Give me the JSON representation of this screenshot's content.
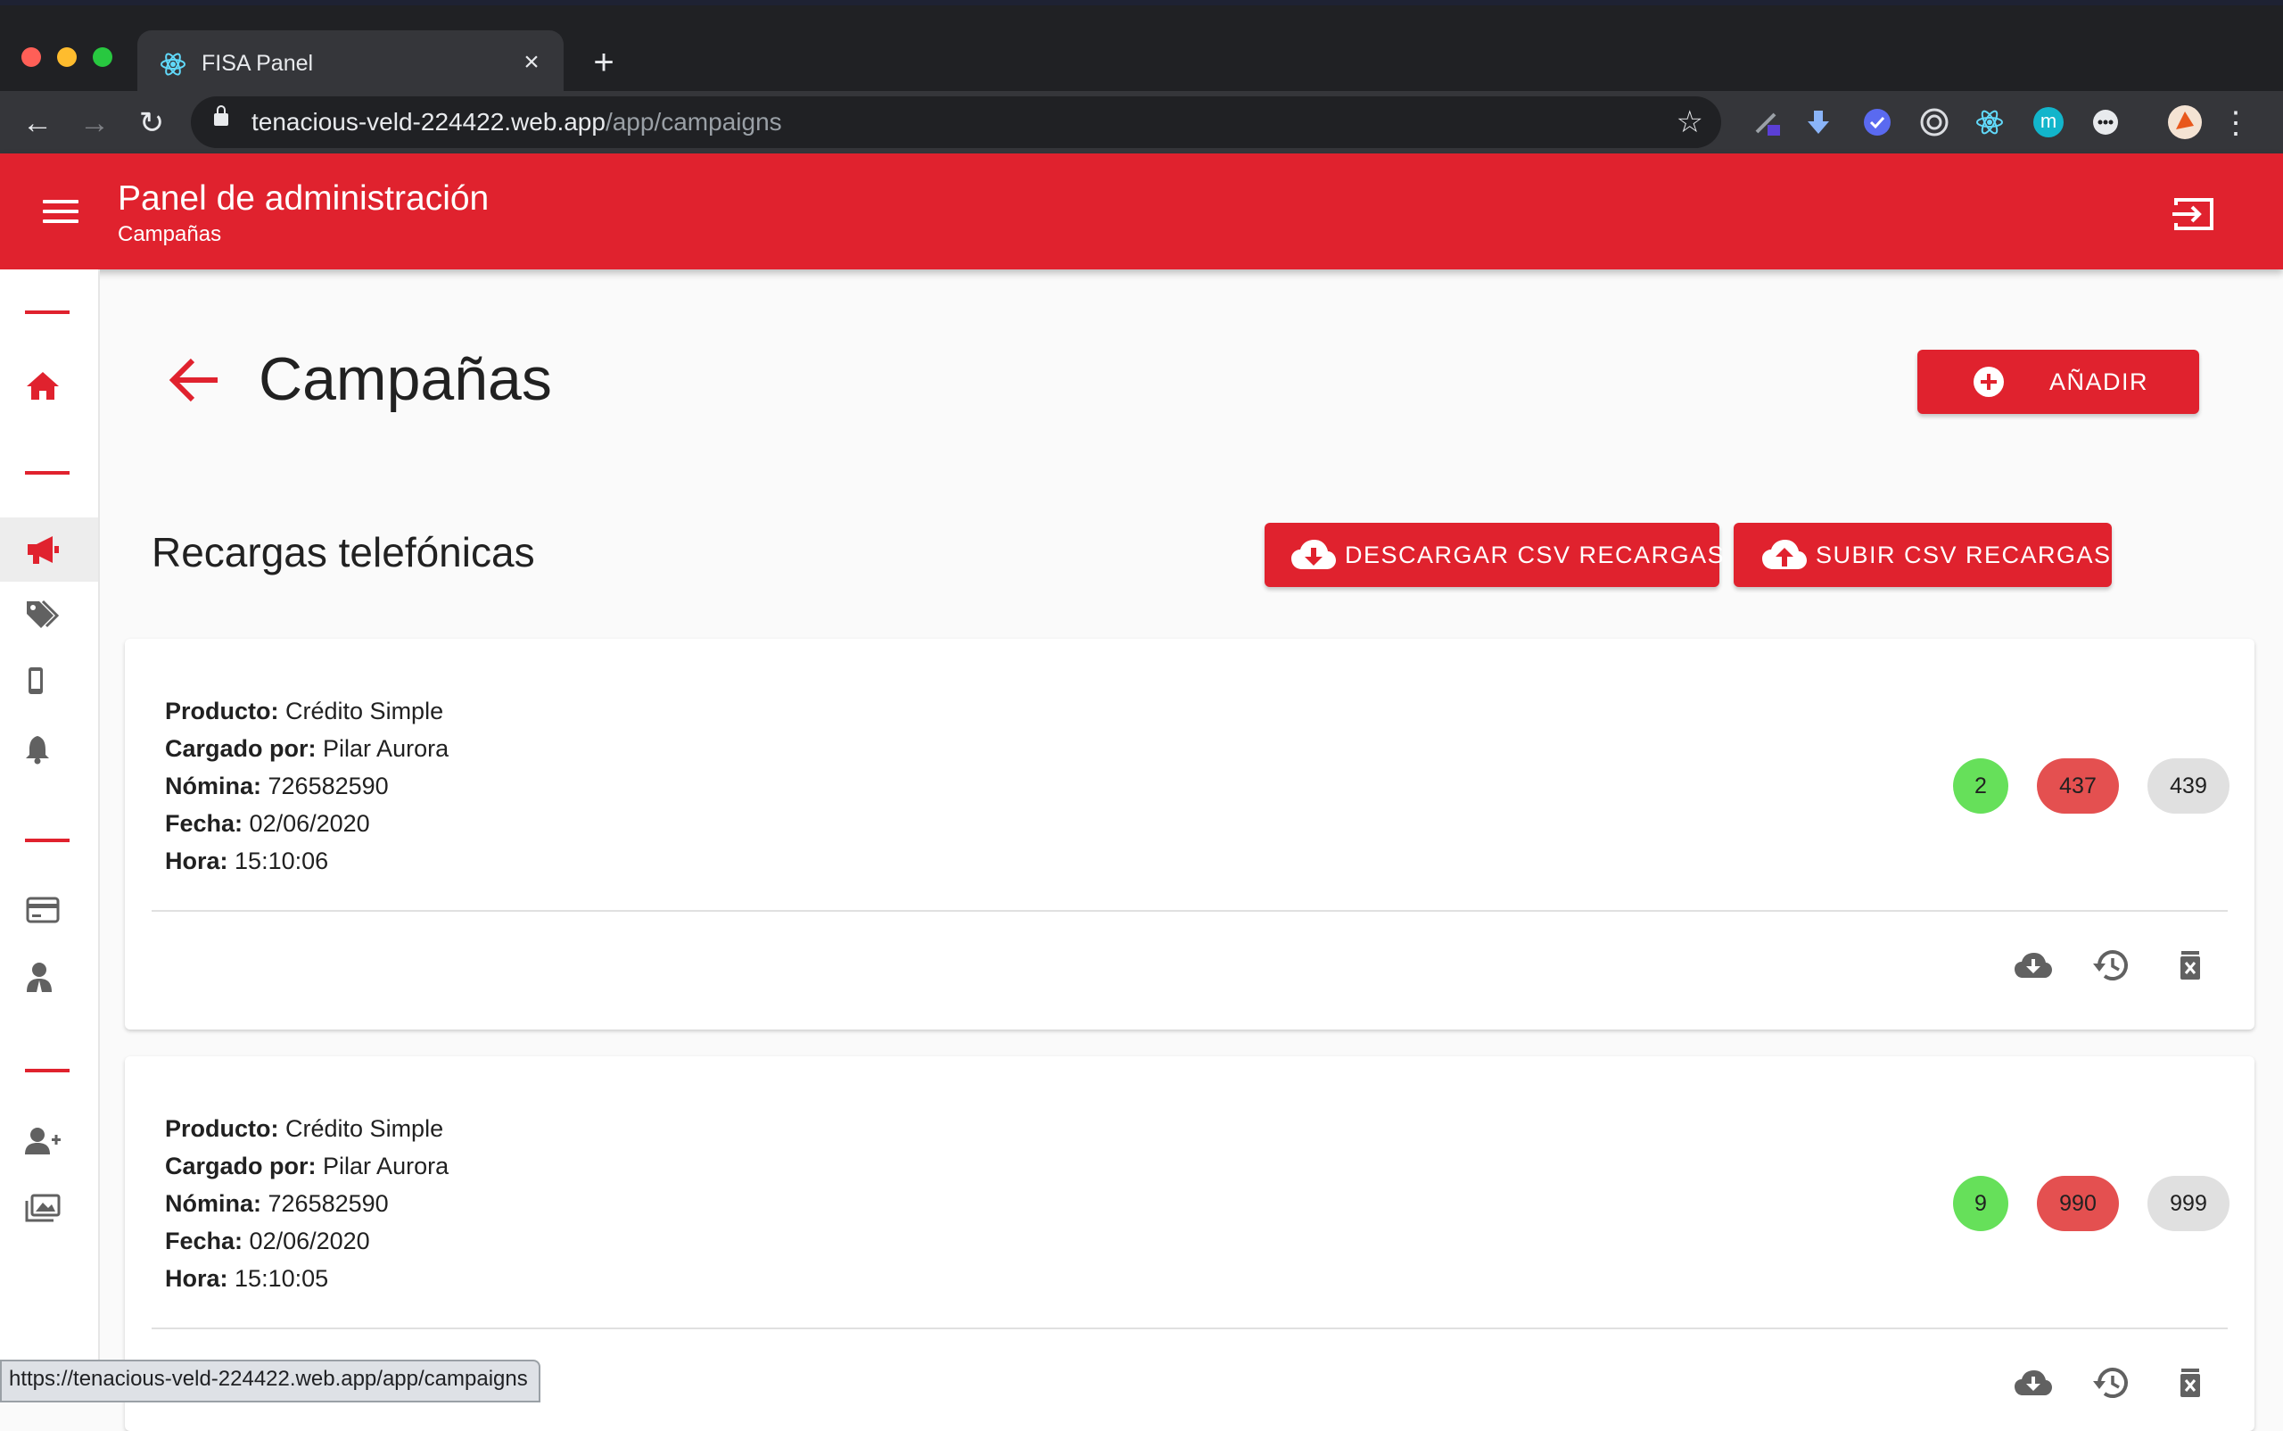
{
  "browser": {
    "tab_title": "FISA Panel",
    "url_host": "tenacious-veld-224422.web.app",
    "url_path": "/app/campaigns",
    "status_url": "https://tenacious-veld-224422.web.app/app/campaigns",
    "extension_letter": "m"
  },
  "appbar": {
    "title": "Panel de administración",
    "subtitle": "Campañas"
  },
  "sidebar": {
    "items": [
      {
        "icon": "home-icon"
      },
      {
        "icon": "megaphone-icon",
        "active": true
      },
      {
        "icon": "tags-icon"
      },
      {
        "icon": "mobile-phone-icon"
      },
      {
        "icon": "bell-icon"
      },
      {
        "icon": "credit-card-icon"
      },
      {
        "icon": "user-tie-icon"
      },
      {
        "icon": "user-plus-icon"
      },
      {
        "icon": "images-icon"
      }
    ]
  },
  "page": {
    "title": "Campañas",
    "add_label": "AÑADIR",
    "section_title": "Recargas telefónicas",
    "download_csv_label": "DESCARGAR CSV RECARGAS",
    "upload_csv_label": "SUBIR CSV RECARGAS"
  },
  "labels": {
    "producto": "Producto:",
    "cargado": "Cargado por:",
    "nomina": "Nómina:",
    "fecha": "Fecha:",
    "hora": "Hora:"
  },
  "campaigns": [
    {
      "producto": "Crédito Simple",
      "cargado_por": "Pilar Aurora",
      "nomina": "726582590",
      "fecha": "02/06/2020",
      "hora": "15:10:06",
      "success": "2",
      "failed": "437",
      "total": "439"
    },
    {
      "producto": "Crédito Simple",
      "cargado_por": "Pilar Aurora",
      "nomina": "726582590",
      "fecha": "02/06/2020",
      "hora": "15:10:05",
      "success": "9",
      "failed": "990",
      "total": "999"
    }
  ],
  "colors": {
    "primary": "#e0222e",
    "success_chip": "#66e05a",
    "error_chip": "#e45050",
    "neutral_chip": "#e0e0e0"
  }
}
